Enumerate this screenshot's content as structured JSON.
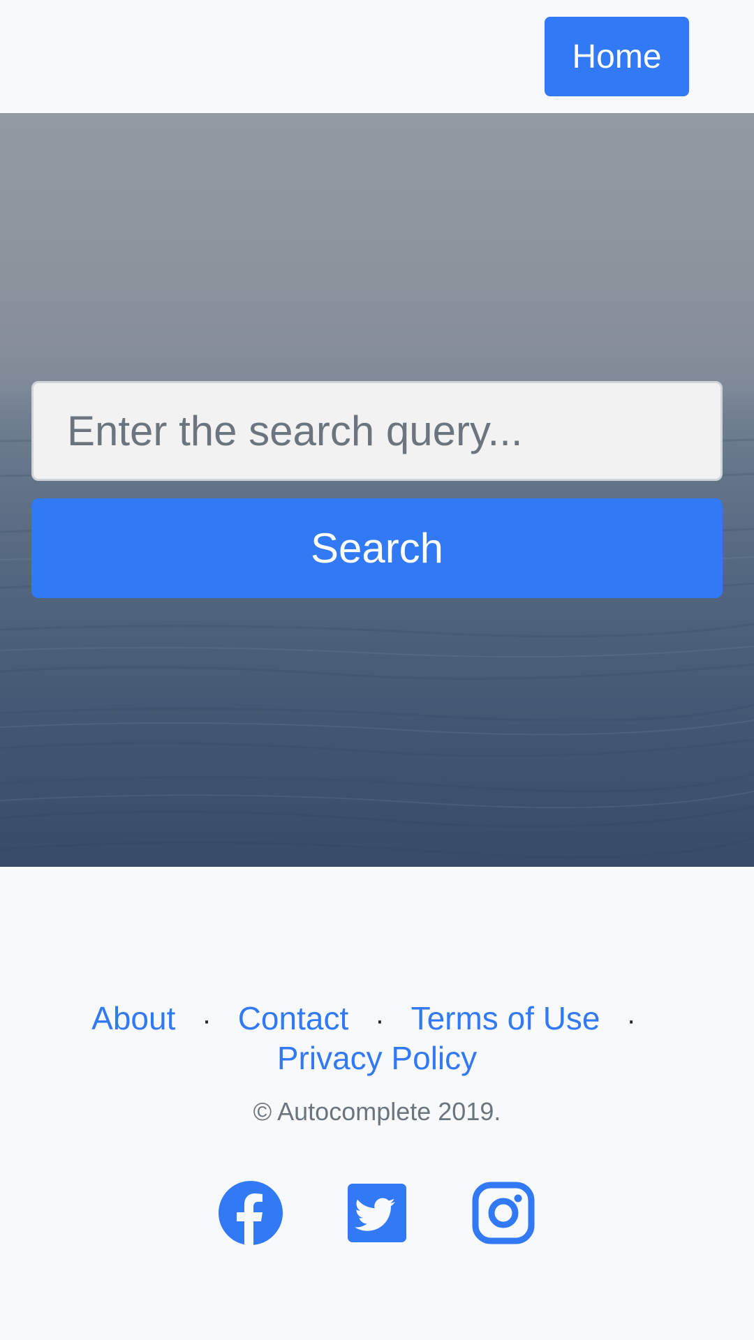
{
  "navbar": {
    "home_label": "Home"
  },
  "search": {
    "placeholder": "Enter the search query...",
    "button_label": "Search"
  },
  "footer": {
    "links": [
      {
        "label": "About"
      },
      {
        "label": "Contact"
      },
      {
        "label": "Terms of Use"
      },
      {
        "label": "Privacy Policy"
      }
    ],
    "separator": "·",
    "copyright": "© Autocomplete 2019.",
    "social": [
      {
        "icon": "facebook-icon"
      },
      {
        "icon": "twitter-icon"
      },
      {
        "icon": "instagram-icon"
      }
    ]
  },
  "colors": {
    "accent": "#3279f6",
    "background": "#f8f9fa",
    "muted_text": "#6c757d"
  }
}
